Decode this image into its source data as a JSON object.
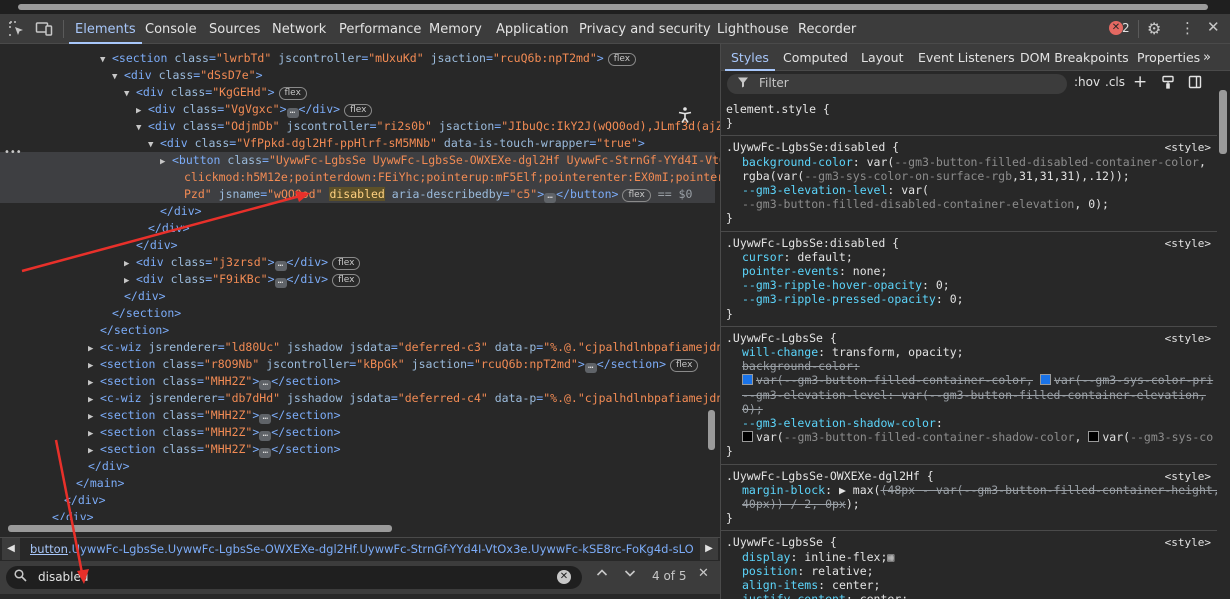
{
  "toolbar": {
    "tabs": [
      "Elements",
      "Console",
      "Sources",
      "Network",
      "Performance",
      "Memory",
      "Application",
      "Privacy and security",
      "Lighthouse",
      "Recorder"
    ],
    "error_count": "2"
  },
  "tree": {
    "lines": [
      {
        "indent": 100,
        "tri": "▼",
        "html": "<span>&lt;section</span> <span class='attr'>class</span>=<span class='av'>\"lwrbTd\"</span> <span class='attr'>jscontroller</span>=<span class='av'>\"mUxuKd\"</span> <span class='attr'>jsaction</span>=<span class='av'>\"rcuQ6b:npT2md\"</span>&gt;<span class='badge'>flex</span>"
      },
      {
        "indent": 112,
        "tri": "▼",
        "html": "&lt;div <span class='attr'>class</span>=<span class='av'>\"dSsD7e\"</span>&gt;"
      },
      {
        "indent": 124,
        "tri": "▼",
        "html": "&lt;div <span class='attr'>class</span>=<span class='av'>\"KgGEHd\"</span>&gt;<span class='badge'>flex</span>"
      },
      {
        "indent": 136,
        "tri": "▶",
        "html": "&lt;div <span class='attr'>class</span>=<span class='av'>\"VgVgxc\"</span>&gt;<span class='ell'>…</span>&lt;/div&gt;<span class='badge'>flex</span>"
      },
      {
        "indent": 136,
        "tri": "▼",
        "html": "&lt;div <span class='attr'>class</span>=<span class='av'>\"OdjmDb\"</span> <span class='attr'>jscontroller</span>=<span class='av'>\"ri2s0b\"</span> <span class='attr'>jsaction</span>=<span class='av'>\"JIbuQc:IkY2J(wQO0od),JLmf3d(ajZL</span>"
      },
      {
        "indent": 148,
        "tri": "▼",
        "html": "&lt;div <span class='attr'>class</span>=<span class='av'>\"VfPpkd-dgl2Hf-ppHlrf-sM5MNb\"</span> <span class='attr'>data-is-touch-wrapper</span>=<span class='av'>\"true\"</span>&gt;"
      },
      {
        "indent": 160,
        "tri": "▶",
        "sel": true,
        "html": "&lt;button <span class='attr'>class</span>=<span class='av'>\"UywwFc-LgbsSe UywwFc-LgbsSe-OWXEXe-dgl2Hf UywwFc-StrnGf-YYd4I-VtOx</span>"
      },
      {
        "indent": 172,
        "tri": "",
        "sel": true,
        "html": "<span class='av'>clickmod:h5M12e;pointerdown:FEiYhc;pointerup:mF5Elf;pointerenter:EX0mI;pointerlea</span>"
      },
      {
        "indent": 172,
        "tri": "",
        "sel": true,
        "html": "<span class='av'>Pzd\"</span> <span class='attr'>jsname</span>=<span class='av'>\"wQO0od\"</span> <span class='hl'>disabled</span> <span class='attr'>aria-describedby</span>=<span class='av'>\"c5\"</span>&gt;<span class='ell'>…</span>&lt;/button&gt;<span class='badge'>flex</span> <span class='dollar'>== $0</span>"
      },
      {
        "indent": 148,
        "tri": "",
        "html": "&lt;/div&gt;"
      },
      {
        "indent": 136,
        "tri": "",
        "html": "&lt;/div&gt;"
      },
      {
        "indent": 124,
        "tri": "",
        "html": "&lt;/div&gt;"
      },
      {
        "indent": 124,
        "tri": "▶",
        "html": "&lt;div <span class='attr'>class</span>=<span class='av'>\"j3zrsd\"</span>&gt;<span class='ell'>…</span>&lt;/div&gt;<span class='badge'>flex</span>"
      },
      {
        "indent": 124,
        "tri": "▶",
        "html": "&lt;div <span class='attr'>class</span>=<span class='av'>\"F9iKBc\"</span>&gt;<span class='ell'>…</span>&lt;/div&gt;<span class='badge'>flex</span>"
      },
      {
        "indent": 112,
        "tri": "",
        "html": "&lt;/div&gt;"
      },
      {
        "indent": 100,
        "tri": "",
        "html": "&lt;/section&gt;"
      },
      {
        "indent": 88,
        "tri": "",
        "html": "&lt;/section&gt;"
      },
      {
        "indent": 88,
        "tri": "▶",
        "html": "&lt;c-wiz <span class='attr'>jsrenderer</span>=<span class='av'>\"ld80Uc\"</span> <span class='attr'>jsshadow</span> <span class='attr'>jsdata</span>=<span class='av'>\"deferred-c3\"</span> <span class='attr'>data-p</span>=<span class='av'>\"%.@.\"cjpalhdlnbpafiamejdnhc</span>"
      },
      {
        "indent": 88,
        "tri": "▶",
        "html": "&lt;section <span class='attr'>class</span>=<span class='av'>\"r8O9Nb\"</span> <span class='attr'>jscontroller</span>=<span class='av'>\"kBpGk\"</span> <span class='attr'>jsaction</span>=<span class='av'>\"rcuQ6b:npT2md\"</span>&gt;<span class='ell'>…</span>&lt;/section&gt;<span class='badge'>flex</span>"
      },
      {
        "indent": 88,
        "tri": "▶",
        "html": "&lt;section <span class='attr'>class</span>=<span class='av'>\"MHH2Z\"</span>&gt;<span class='ell'>…</span>&lt;/section&gt;"
      },
      {
        "indent": 88,
        "tri": "▶",
        "html": "&lt;c-wiz <span class='attr'>jsrenderer</span>=<span class='av'>\"db7dHd\"</span> <span class='attr'>jsshadow</span> <span class='attr'>jsdata</span>=<span class='av'>\"deferred-c4\"</span> <span class='attr'>data-p</span>=<span class='av'>\"%.@.\"cjpalhdlnbpafiamejdnhc</span>"
      },
      {
        "indent": 88,
        "tri": "▶",
        "html": "&lt;section <span class='attr'>class</span>=<span class='av'>\"MHH2Z\"</span>&gt;<span class='ell'>…</span>&lt;/section&gt;"
      },
      {
        "indent": 88,
        "tri": "▶",
        "html": "&lt;section <span class='attr'>class</span>=<span class='av'>\"MHH2Z\"</span>&gt;<span class='ell'>…</span>&lt;/section&gt;"
      },
      {
        "indent": 88,
        "tri": "▶",
        "html": "&lt;section <span class='attr'>class</span>=<span class='av'>\"MHH2Z\"</span>&gt;<span class='ell'>…</span>&lt;/section&gt;"
      },
      {
        "indent": 76,
        "tri": "",
        "html": "&lt;/div&gt;"
      },
      {
        "indent": 64,
        "tri": "",
        "html": "&lt;/main&gt;"
      },
      {
        "indent": 52,
        "tri": "",
        "html": "&lt;/div&gt;"
      },
      {
        "indent": 40,
        "tri": "",
        "html": "&lt;/div&gt;"
      }
    ]
  },
  "breadcrumb": {
    "tag": "button",
    "rest": ".UywwFc-LgbsSe.UywwFc-LgbsSe-OWXEXe-dgl2Hf.UywwFc-StrnGf-YYd4I-VtOx3e.UywwFc-kSE8rc-FoKg4d-sLO9V-YoZ4jf"
  },
  "search": {
    "value": "disabled",
    "match_count": "4 of 5"
  },
  "styles": {
    "tabs": [
      "Styles",
      "Computed",
      "Layout",
      "Event Listeners",
      "DOM Breakpoints",
      "Properties"
    ],
    "filter_placeholder": "Filter",
    "hov": ":hov",
    "cls": ".cls",
    "source": "<style>"
  },
  "rules": [
    {
      "lines": [
        "element.style {",
        "}"
      ]
    },
    {
      "lines": [
        ".UywwFc-LgbsSe:disabled {",
        "<span class='prop'>background-color</span>: var(<span class='dim'>--gm3-button-filled-disabled-container-color</span>,",
        "     rgba(var(<span class='dim'>--gm3-sys-color-on-surface-rgb</span>,31,31,31),.12));",
        "<span class='prop'>--gm3-elevation-level</span>: var(",
        "     <span class='dim'>--gm3-button-filled-disabled-container-elevation</span>, 0);",
        "}"
      ]
    },
    {
      "lines": [
        ".UywwFc-LgbsSe:disabled {",
        "<span class='prop'>cursor</span>: default;",
        "<span class='prop'>pointer-events</span>: none;",
        "<span class='prop'>--gm3-ripple-hover-opacity</span>: 0;",
        "<span class='prop'>--gm3-ripple-pressed-opacity</span>: 0;",
        "}"
      ]
    },
    {
      "lines": [
        ".UywwFc-LgbsSe {",
        "<span class='prop'>will-change</span>: transform, opacity;",
        "<span class='strike'>background-color: </span>",
        "     <span class='sw' style='background:#1a73e8'></span><span class='strike'>var(--gm3-button-filled-container-color,</span> <span class='sw' style='background:#1a73e8'></span><span class='strike'>var(--gm3-sys-color-pri</span>",
        "<span class='strike'>--gm3-elevation-level: var(--gm3-button-filled-container-elevation,</span>",
        "     <span class='strike'>0);</span>",
        "<span class='prop'>--gm3-elevation-shadow-color</span>:",
        "     <span class='sw' style='background:#000'></span>var(<span class='dim'>--gm3-button-filled-container-shadow-color</span>, <span class='sw' style='background:#000'></span>var(<span class='dim'>--gm3-sys-co</span>",
        "}"
      ]
    },
    {
      "lines": [
        ".UywwFc-LgbsSe-OWXEXe-dgl2Hf {",
        "<span class='prop'>margin-block</span>: ▶ max(<span class='strike'>(48px - var(--gm3-button-filled-container-height,</span>",
        "     <span class='strike'>40px)) / 2, 0px</span>);",
        "}"
      ]
    },
    {
      "lines": [
        ".UywwFc-LgbsSe {",
        "<span class='prop'>display</span>: inline-flex;<span style='color:#c7c7c7'>▦</span>",
        "<span class='prop'>position</span>: relative;",
        "<span class='prop'>align-items</span>: center;",
        "<span class='prop'>justify-content</span>: center;"
      ]
    }
  ]
}
